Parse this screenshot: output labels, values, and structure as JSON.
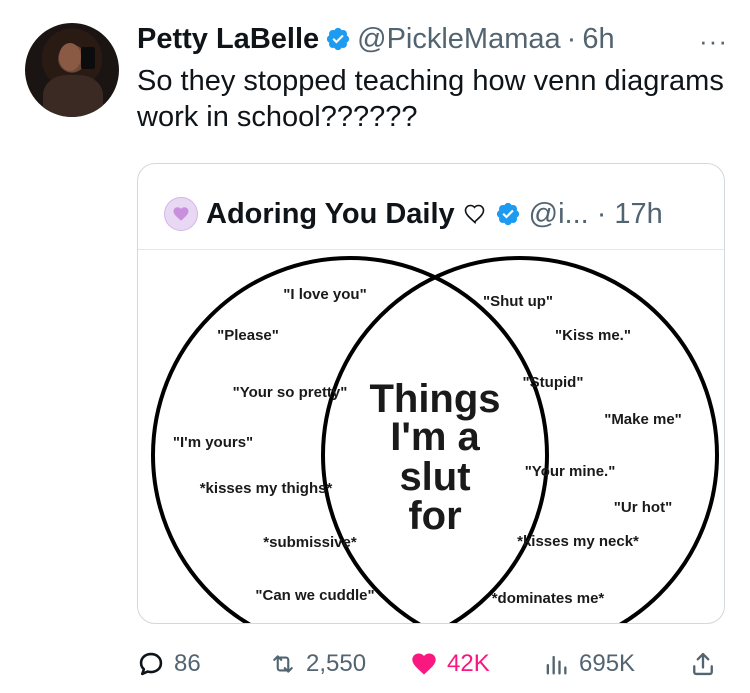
{
  "tweet": {
    "author_name": "Petty LaBelle",
    "author_handle": "@PickleMamaa",
    "separator": "·",
    "time": "6h",
    "more": "···",
    "text": "So they stopped teaching how venn diagrams work in school??????"
  },
  "quoted_tweet": {
    "author_name": "Adoring You Daily",
    "author_handle": "@i...",
    "separator": "·",
    "time": "17h",
    "diagram": {
      "left_items": [
        "\"I love you\"",
        "\"Please\"",
        "\"Your so pretty\"",
        "\"I'm yours\"",
        "*kisses my thighs*",
        "*submissive*",
        "\"Can we cuddle\""
      ],
      "right_items": [
        "\"Shut up\"",
        "\"Kiss me.\"",
        "\"Stupid\"",
        "\"Make me\"",
        "\"Your mine.\"",
        "\"Ur hot\"",
        "*kisses my neck*",
        "*dominates me*"
      ],
      "center_lines": [
        "Things",
        "I'm a",
        "slut",
        "for"
      ]
    }
  },
  "actions": {
    "replies": "86",
    "retweets": "2,550",
    "likes": "42K",
    "views": "695K"
  },
  "colors": {
    "verified": "#1d9bf0",
    "like": "#f91880",
    "secondary_text": "#536471",
    "border": "#cfd9de"
  },
  "icons": [
    "verified-badge-icon",
    "more-icon",
    "heart-outline-icon",
    "reply-icon",
    "retweet-icon",
    "like-icon",
    "views-icon",
    "share-icon"
  ]
}
